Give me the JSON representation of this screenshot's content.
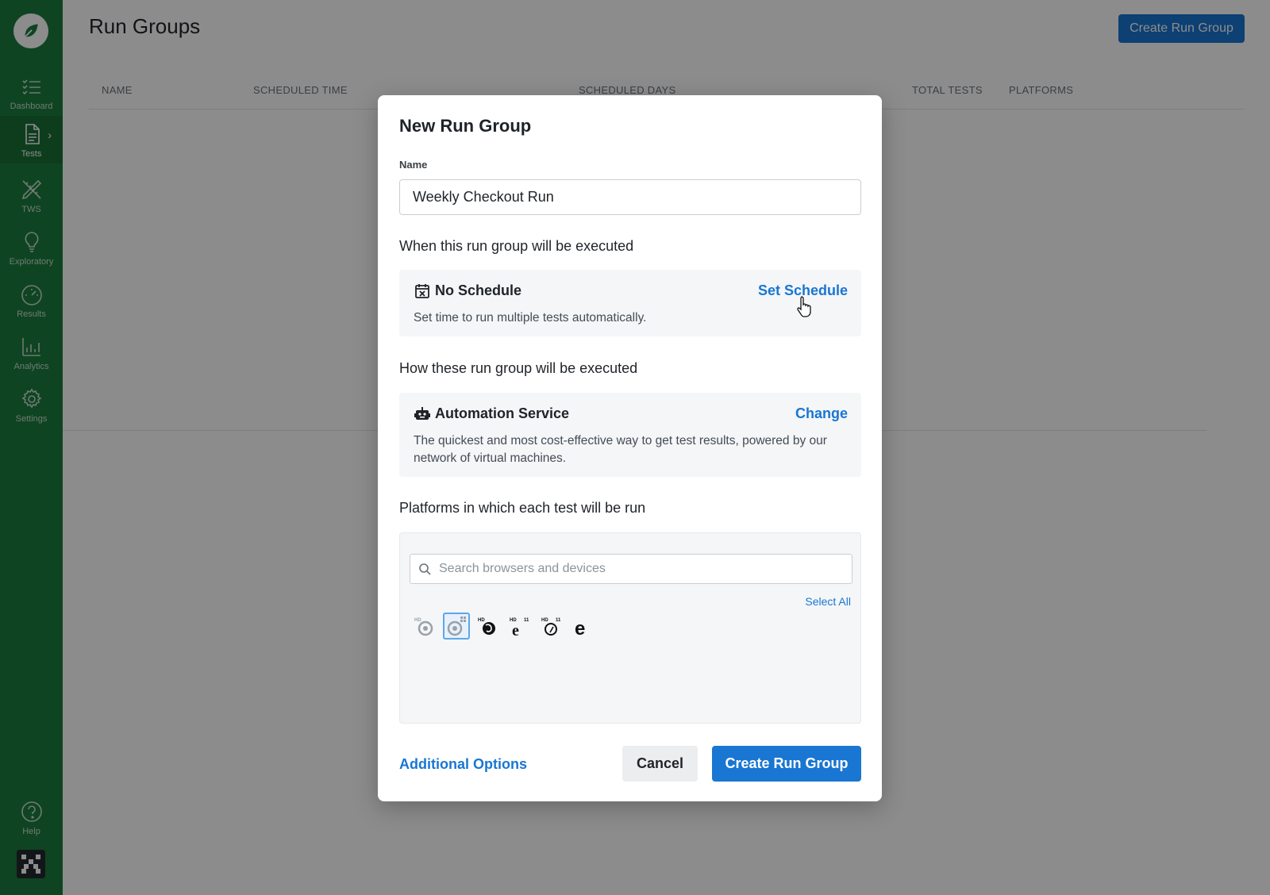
{
  "sidebar": {
    "items": [
      {
        "label": "Dashboard",
        "icon": "list-checks-icon"
      },
      {
        "label": "Tests",
        "icon": "document-icon",
        "active": true
      },
      {
        "label": "TWS",
        "icon": "pencil-ruler-icon"
      },
      {
        "label": "Exploratory",
        "icon": "lightbulb-icon"
      },
      {
        "label": "Results",
        "icon": "gauge-icon"
      },
      {
        "label": "Analytics",
        "icon": "bar-chart-icon"
      },
      {
        "label": "Settings",
        "icon": "gear-icon"
      }
    ],
    "help_label": "Help"
  },
  "page": {
    "title": "Run Groups",
    "create_button": "Create Run Group",
    "columns": [
      "NAME",
      "SCHEDULED TIME",
      "SCHEDULED DAYS",
      "TOTAL TESTS",
      "PLATFORMS"
    ]
  },
  "modal": {
    "title": "New Run Group",
    "name_label": "Name",
    "name_value": "Weekly Checkout Run",
    "schedule_heading": "When this run group will be executed",
    "schedule": {
      "title": "No Schedule",
      "link": "Set Schedule",
      "description": "Set time to run multiple tests automatically."
    },
    "execution_heading": "How these run group will be executed",
    "execution": {
      "title": "Automation Service",
      "link": "Change",
      "description": "The quickest and most cost-effective way to get test results, powered by our network of virtual machines."
    },
    "platforms_heading": "Platforms in which each test will be run",
    "search_placeholder": "Search browsers and devices",
    "select_all": "Select All",
    "browsers": [
      {
        "name": "chrome-hd-icon",
        "selected": false
      },
      {
        "name": "chrome-windows-icon",
        "selected": true
      },
      {
        "name": "firefox-hd-icon",
        "selected": false
      },
      {
        "name": "ie11-hd-icon",
        "selected": false
      },
      {
        "name": "safari-hd-icon",
        "selected": false
      },
      {
        "name": "edge-icon",
        "selected": false
      }
    ],
    "additional_options": "Additional Options",
    "cancel": "Cancel",
    "create": "Create Run Group"
  },
  "colors": {
    "sidebar": "#1d7d3f",
    "primary": "#1976d2"
  }
}
